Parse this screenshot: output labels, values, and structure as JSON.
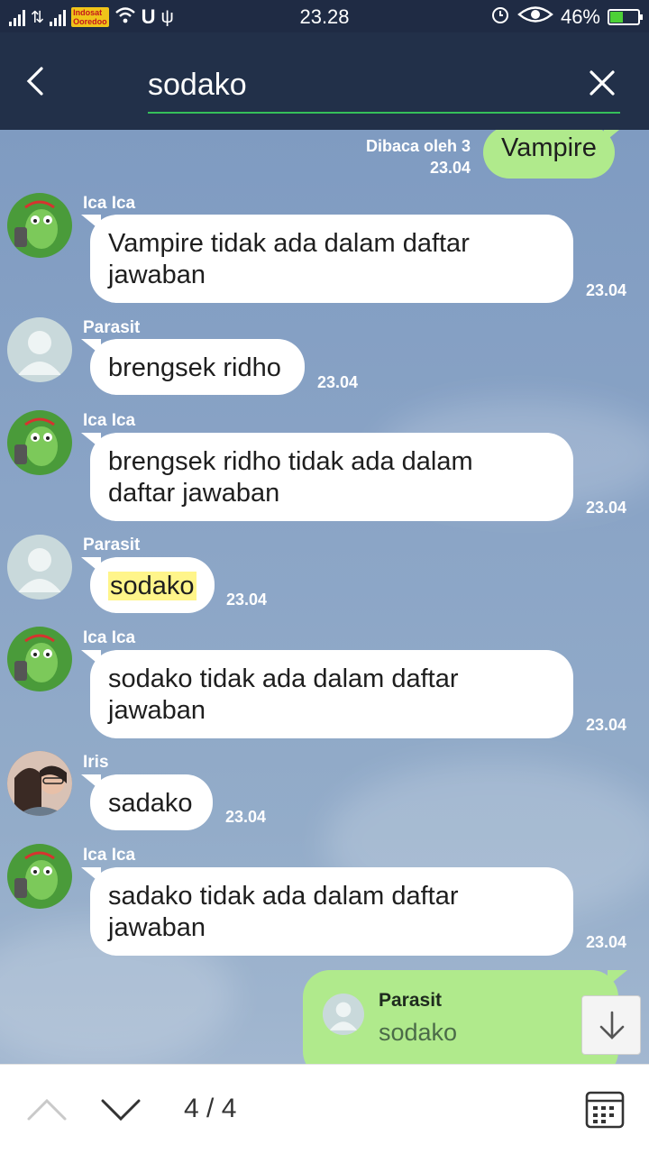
{
  "status_bar": {
    "time": "23.28",
    "battery": "46%",
    "battery_level": 0.46,
    "carrier_tag": "Indosat Ooredoo",
    "icons": [
      "signal-icon",
      "data-icon",
      "signal-icon",
      "wifi-icon",
      "u-icon",
      "usb-icon",
      "alarm-icon",
      "eye-icon",
      "battery-icon"
    ]
  },
  "search": {
    "query": "sodako",
    "back_icon": "chevron-left-icon",
    "clear_icon": "close-icon"
  },
  "messages": [
    {
      "type": "outgoing",
      "text": "Vampire",
      "read": "Dibaca oleh 3",
      "time": "23.04"
    },
    {
      "type": "incoming",
      "sender": "Ica Ica",
      "avatar": "bot-avatar",
      "lines": [
        "Vampire tidak ada dalam daftar",
        "jawaban"
      ],
      "time": "23.04"
    },
    {
      "type": "incoming",
      "sender": "Parasit",
      "avatar": "default-avatar",
      "lines": [
        "brengsek ridho"
      ],
      "time": "23.04"
    },
    {
      "type": "incoming",
      "sender": "Ica Ica",
      "avatar": "bot-avatar",
      "lines": [
        "brengsek ridho tidak ada dalam",
        "daftar jawaban"
      ],
      "time": "23.04"
    },
    {
      "type": "incoming",
      "sender": "Parasit",
      "avatar": "default-avatar",
      "text": "sodako",
      "highlighted": true,
      "time": "23.04"
    },
    {
      "type": "incoming",
      "sender": "Ica Ica",
      "avatar": "bot-avatar",
      "lines": [
        "sodako tidak ada dalam daftar",
        "jawaban"
      ],
      "time": "23.04"
    },
    {
      "type": "incoming",
      "sender": "Iris",
      "avatar": "photo-avatar",
      "lines": [
        "sadako"
      ],
      "time": "23.04"
    },
    {
      "type": "incoming",
      "sender": "Ica Ica",
      "avatar": "bot-avatar",
      "lines": [
        "sadako tidak ada dalam daftar",
        "jawaban"
      ],
      "time": "23.04"
    }
  ],
  "reply_preview": {
    "name": "Parasit",
    "text": "sodako"
  },
  "bottom_bar": {
    "counter": "4 / 4",
    "up_icon": "chevron-up-icon",
    "down_icon": "chevron-down-icon",
    "calendar_icon": "calendar-icon"
  },
  "colors": {
    "header_bg": "#223049",
    "search_underline": "#35c05a",
    "outgoing_bubble": "#b0ea8c",
    "highlight": "#fff58a"
  }
}
